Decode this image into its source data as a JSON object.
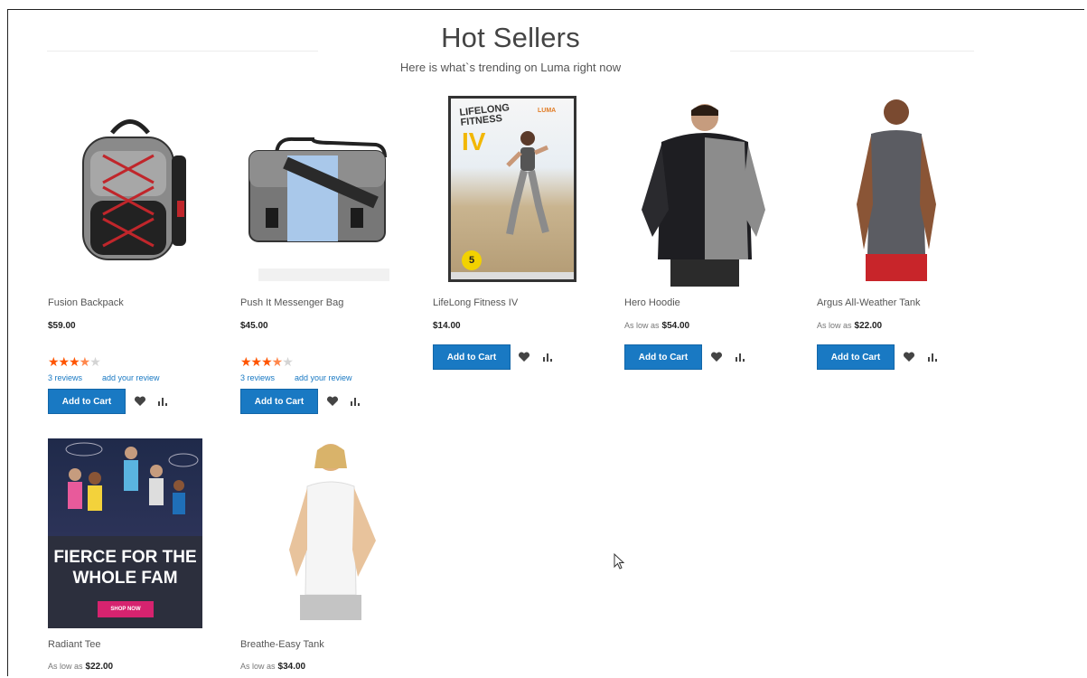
{
  "section": {
    "title": "Hot Sellers",
    "subtitle": "Here is what`s trending on Luma right now"
  },
  "colors": {
    "accent": "#1979c3",
    "star": "#ff5501",
    "star_off": "#d4d4d4"
  },
  "products": [
    {
      "name": "Fusion Backpack",
      "price": "$59.00",
      "rating": 3.5,
      "reviews_label": "3  reviews",
      "add_review_label": "add your review",
      "add_to_cart": "Add to Cart"
    },
    {
      "name": "Push It Messenger Bag",
      "price": "$45.00",
      "rating": 3.5,
      "reviews_label": "3  reviews",
      "add_review_label": "add your review",
      "add_to_cart": "Add to Cart"
    },
    {
      "name": "LifeLong Fitness IV",
      "price": "$14.00",
      "add_to_cart": "Add to Cart"
    },
    {
      "name": "Hero Hoodie",
      "as_low_as": "As low as",
      "price": "$54.00",
      "add_to_cart": "Add to Cart"
    },
    {
      "name": "Argus All-Weather Tank",
      "as_low_as": "As low as",
      "price": "$22.00",
      "add_to_cart": "Add to Cart"
    },
    {
      "name": "Radiant Tee",
      "as_low_as": "As low as",
      "price": "$22.00"
    },
    {
      "name": "Breathe-Easy Tank",
      "as_low_as": "As low as",
      "price": "$34.00"
    }
  ],
  "dvd": {
    "line1": "LIFELONG",
    "line2": "FITNESS",
    "line3": "IV",
    "brand": "LUMA",
    "badge": "5"
  },
  "banner": {
    "headline1": "FIERCE FOR THE",
    "headline2": "WHOLE FAM",
    "cta": "SHOP NOW"
  },
  "icons": {
    "wishlist": "heart-icon",
    "compare": "compare-bars-icon",
    "cursor": "mouse-cursor-icon"
  }
}
